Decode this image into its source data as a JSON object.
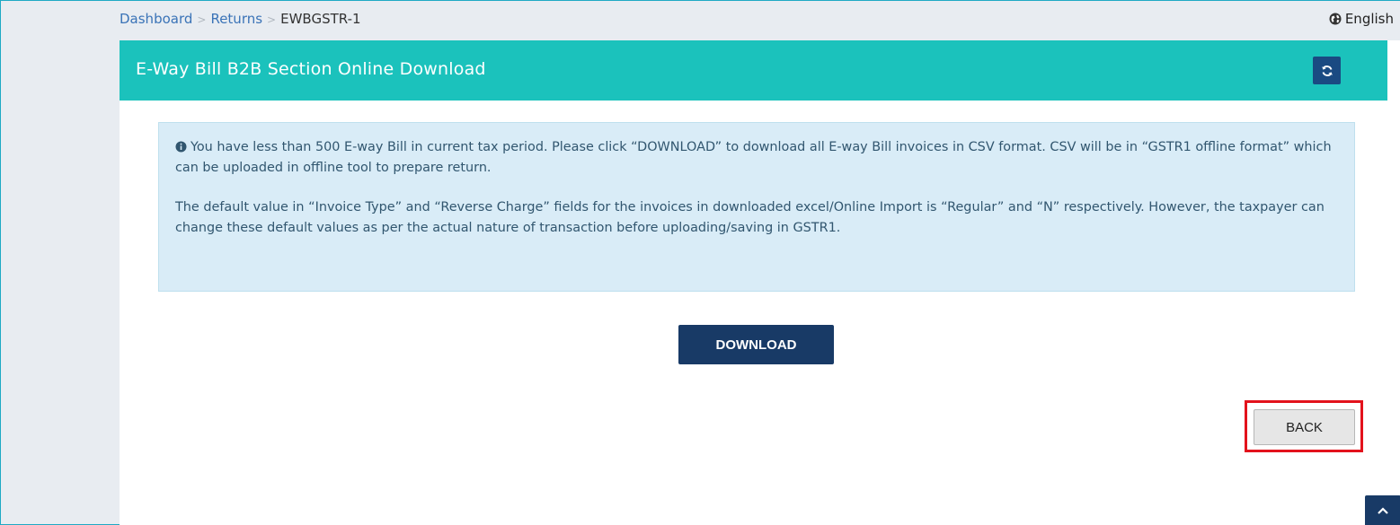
{
  "breadcrumb": {
    "items": [
      "Dashboard",
      "Returns"
    ],
    "current": "EWBGSTR-1",
    "separator": ">"
  },
  "language": {
    "label": "English",
    "icon": "globe-icon"
  },
  "section": {
    "title": "E-Way Bill B2B Section Online Download",
    "refresh_icon": "refresh-icon"
  },
  "info": {
    "icon": "info-circle-icon",
    "paragraph1": "You have less than 500 E-way Bill in current tax period. Please click “DOWNLOAD” to download all E-way Bill invoices in CSV format. CSV will be in “GSTR1 offline format” which can be uploaded in offline tool to prepare return.",
    "paragraph2": "The default value in “Invoice Type” and “Reverse Charge” fields for the invoices in downloaded excel/Online Import is “Regular” and “N” respectively. However, the taxpayer can change these default values as per the actual nature of transaction before uploading/saving in GSTR1."
  },
  "actions": {
    "download_label": "DOWNLOAD",
    "back_label": "BACK",
    "scroll_top_icon": "chevron-up-icon"
  },
  "colors": {
    "header_teal": "#1bc2bc",
    "navy": "#183a66",
    "info_bg": "#d9ecf7",
    "highlight_red": "#e3121c",
    "link_blue": "#3a73b7"
  }
}
